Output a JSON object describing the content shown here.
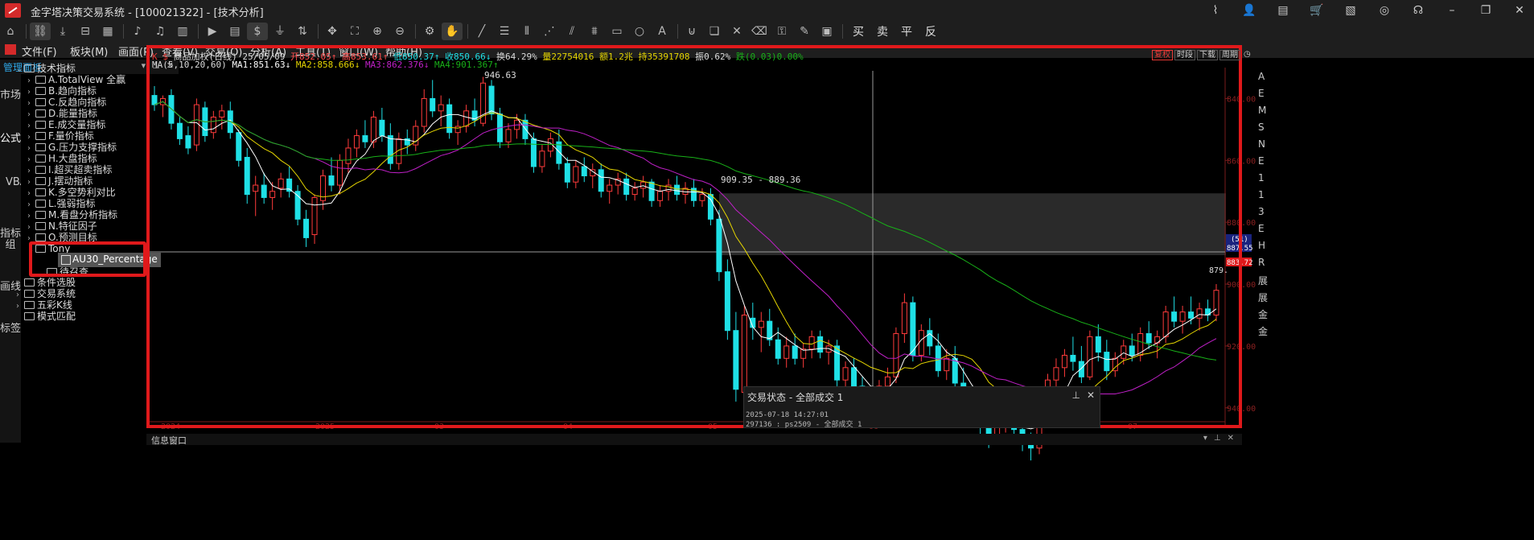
{
  "window": {
    "title": "金字塔决策交易系统 - [100021322] - [技术分析]"
  },
  "toolbar": {
    "trade_buttons": [
      "买",
      "卖",
      "平",
      "反"
    ]
  },
  "menu": {
    "items": [
      "文件(F)",
      "板块(M)",
      "画面(P)",
      "查看(V)",
      "交易(O)",
      "分析(A)",
      "工具(T)",
      "窗口(W)",
      "帮助(H)"
    ]
  },
  "side_tabs": {
    "items": [
      "市场",
      "公式",
      "VBA",
      "指标组",
      "画线",
      "标签"
    ]
  },
  "panel": {
    "title": "管理面板",
    "controls": [
      "▾",
      "⊥",
      "✕"
    ]
  },
  "tree": {
    "root": "技术指标",
    "items": [
      "A.TotalView 全赢",
      "B.趋向指标",
      "C.反趋向指标",
      "D.能量指标",
      "E.成交量指标",
      "F.量价指标",
      "G.压力支撑指标",
      "H.大盘指标",
      "I.超买超卖指标",
      "J.摆动指标",
      "K.多空势利对比",
      "L.强弱指标",
      "M.看盘分析指标",
      "N.特征因子",
      "O.预测目标"
    ],
    "tony": "Tony",
    "selected": "AU30_Percentage",
    "hidden_partial": "待召查",
    "roots_after": [
      "条件选股",
      "交易系统",
      "五彩K线"
    ],
    "last": "模式匹配"
  },
  "chart": {
    "header": {
      "name": "商品加权(日线)",
      "date": "25/05/09",
      "open": "开852.05",
      "high": "高853.61",
      "low": "低850.37",
      "close": "收850.66",
      "turnover": "换64.29%",
      "volume": "量22754016",
      "amount": "额1.2兆",
      "open_interest": "持35391708",
      "amplitude": "振0.62%",
      "change": "跌(0.03)0.00%"
    },
    "ma_line": {
      "label": "MA(5,10,20,60)",
      "ma1": "MA1:851.63",
      "ma2": "MA2:858.666",
      "ma3": "MA3:862.376",
      "ma4": "MA4:901.367"
    },
    "buttons": [
      "复权",
      "时段",
      "下载",
      "周期"
    ],
    "annotations": {
      "peak": "946.63",
      "range": "909.35 - 889.36",
      "cursor_tag": "(51)",
      "cursor_price": "887.55",
      "last_price": "883.72",
      "trough_price": "879."
    },
    "y_ticks": [
      "940.00",
      "920.00",
      "900.00",
      "880.00",
      "860.00",
      "840.00"
    ],
    "x_ticks": [
      "2024",
      "2025",
      "03",
      "04",
      "05",
      "06",
      "07"
    ],
    "colors": {
      "up": "#ff3b3b",
      "down": "#1fe0e6",
      "ma1": "#ffffff",
      "ma2": "#e5d500",
      "ma3": "#c020c8",
      "ma4": "#18b018",
      "highlight": "#e0191b"
    }
  },
  "chart_data": {
    "type": "candlestick",
    "title": "商品加权(日线)",
    "series": [
      {
        "name": "商品加权(日线)",
        "ohlc": [
          [
            941,
            944,
            936,
            938
          ],
          [
            938,
            941,
            934,
            940
          ],
          [
            941,
            943,
            930,
            932
          ],
          [
            932,
            934,
            925,
            927
          ],
          [
            928,
            931,
            922,
            924
          ],
          [
            925,
            940,
            923,
            938
          ],
          [
            937,
            939,
            926,
            928
          ],
          [
            929,
            936,
            927,
            934
          ],
          [
            934,
            938,
            930,
            936
          ],
          [
            936,
            939,
            927,
            929
          ],
          [
            929,
            930,
            918,
            920
          ],
          [
            921,
            924,
            906,
            909
          ],
          [
            910,
            915,
            902,
            912
          ],
          [
            912,
            916,
            906,
            908
          ],
          [
            908,
            913,
            904,
            910
          ],
          [
            911,
            916,
            908,
            914
          ],
          [
            914,
            918,
            908,
            910
          ],
          [
            910,
            912,
            899,
            901
          ],
          [
            901,
            904,
            892,
            895
          ],
          [
            896,
            909,
            893,
            908
          ],
          [
            907,
            917,
            904,
            915
          ],
          [
            915,
            921,
            910,
            912
          ],
          [
            912,
            922,
            909,
            920
          ],
          [
            919,
            927,
            916,
            924
          ],
          [
            924,
            930,
            921,
            928
          ],
          [
            928,
            933,
            924,
            926
          ],
          [
            926,
            936,
            924,
            934
          ],
          [
            933,
            937,
            926,
            928
          ],
          [
            928,
            932,
            917,
            919
          ],
          [
            919,
            929,
            917,
            927
          ],
          [
            927,
            930,
            922,
            925
          ],
          [
            925,
            933,
            923,
            931
          ],
          [
            931,
            943,
            929,
            940
          ],
          [
            940,
            946,
            934,
            936
          ],
          [
            936,
            941,
            931,
            938
          ],
          [
            938,
            940,
            927,
            929
          ],
          [
            929,
            933,
            925,
            931
          ],
          [
            931,
            938,
            929,
            936
          ],
          [
            936,
            940,
            931,
            933
          ],
          [
            932,
            947,
            931,
            945
          ],
          [
            944,
            946,
            933,
            935
          ],
          [
            935,
            937,
            924,
            926
          ],
          [
            926,
            932,
            924,
            930
          ],
          [
            930,
            935,
            927,
            933
          ],
          [
            933,
            935,
            925,
            927
          ],
          [
            927,
            929,
            916,
            918
          ],
          [
            918,
            925,
            916,
            923
          ],
          [
            923,
            929,
            921,
            927
          ],
          [
            926,
            930,
            917,
            919
          ],
          [
            919,
            921,
            911,
            913
          ],
          [
            913,
            920,
            911,
            918
          ],
          [
            918,
            921,
            913,
            915
          ],
          [
            915,
            919,
            911,
            917
          ],
          [
            917,
            919,
            908,
            910
          ],
          [
            910,
            914,
            906,
            912
          ],
          [
            912,
            916,
            909,
            914
          ],
          [
            914,
            916,
            907,
            909
          ],
          [
            909,
            913,
            907,
            911
          ],
          [
            911,
            915,
            908,
            913
          ],
          [
            913,
            914,
            905,
            907
          ],
          [
            907,
            912,
            905,
            910
          ],
          [
            910,
            914,
            907,
            912
          ],
          [
            912,
            915,
            907,
            909
          ],
          [
            909,
            913,
            906,
            911
          ],
          [
            911,
            914,
            905,
            907
          ],
          [
            907,
            911,
            905,
            909
          ],
          [
            909,
            911,
            899,
            901
          ],
          [
            901,
            904,
            881,
            884
          ],
          [
            884,
            888,
            862,
            865
          ],
          [
            865,
            871,
            842,
            846
          ],
          [
            845,
            873,
            843,
            870
          ],
          [
            869,
            874,
            862,
            866
          ],
          [
            866,
            871,
            858,
            868
          ],
          [
            868,
            872,
            860,
            862
          ],
          [
            862,
            866,
            854,
            856
          ],
          [
            856,
            863,
            853,
            860
          ],
          [
            860,
            864,
            854,
            856
          ],
          [
            856,
            861,
            853,
            859
          ],
          [
            859,
            865,
            856,
            863
          ],
          [
            863,
            865,
            856,
            858
          ],
          [
            858,
            862,
            854,
            860
          ],
          [
            860,
            862,
            847,
            849
          ],
          [
            849,
            855,
            846,
            853
          ],
          [
            853,
            856,
            845,
            847
          ],
          [
            847,
            850,
            840,
            842
          ],
          [
            842,
            846,
            837,
            844
          ],
          [
            844,
            849,
            841,
            847
          ],
          [
            847,
            853,
            845,
            850
          ],
          [
            850,
            866,
            848,
            864
          ],
          [
            864,
            877,
            861,
            874
          ],
          [
            874,
            876,
            855,
            857
          ],
          [
            857,
            867,
            855,
            865
          ],
          [
            865,
            869,
            857,
            860
          ],
          [
            860,
            864,
            850,
            852
          ],
          [
            852,
            859,
            849,
            856
          ],
          [
            856,
            860,
            846,
            848
          ],
          [
            848,
            853,
            841,
            843
          ],
          [
            843,
            847,
            835,
            838
          ],
          [
            838,
            842,
            831,
            834
          ],
          [
            834,
            837,
            827,
            830
          ],
          [
            830,
            836,
            828,
            834
          ],
          [
            834,
            845,
            832,
            843
          ],
          [
            843,
            846,
            831,
            833
          ],
          [
            833,
            838,
            826,
            829
          ],
          [
            829,
            832,
            823,
            827
          ],
          [
            827,
            840,
            825,
            838
          ],
          [
            838,
            851,
            836,
            849
          ],
          [
            849,
            856,
            846,
            853
          ],
          [
            853,
            859,
            850,
            857
          ],
          [
            857,
            863,
            852,
            855
          ],
          [
            855,
            860,
            848,
            850
          ],
          [
            850,
            865,
            849,
            863
          ],
          [
            863,
            867,
            855,
            858
          ],
          [
            858,
            862,
            849,
            852
          ],
          [
            852,
            858,
            850,
            856
          ],
          [
            856,
            862,
            854,
            860
          ],
          [
            860,
            864,
            855,
            857
          ],
          [
            857,
            866,
            855,
            864
          ],
          [
            864,
            868,
            859,
            861
          ],
          [
            861,
            865,
            856,
            863
          ],
          [
            863,
            873,
            861,
            871
          ],
          [
            871,
            876,
            866,
            868
          ],
          [
            868,
            873,
            864,
            871
          ],
          [
            871,
            876,
            867,
            869
          ],
          [
            869,
            874,
            865,
            872
          ],
          [
            872,
            875,
            868,
            870
          ],
          [
            870,
            880,
            868,
            878
          ]
        ]
      }
    ],
    "ylim": [
      835,
      950
    ],
    "y_ticks": [
      840,
      860,
      880,
      900,
      920,
      940
    ],
    "x_labels": [
      "2024",
      "2025",
      "03",
      "04",
      "05",
      "06",
      "07"
    ],
    "moving_averages": [
      5,
      10,
      20,
      60
    ],
    "shaded_range": [
      889.36,
      909.35
    ],
    "grid": false,
    "legend": "top-left"
  },
  "trade_panel": {
    "title": "交易状态 - 全部成交 1",
    "controls": [
      "⊥",
      "✕"
    ],
    "lines": [
      "2025-07-18 14:27:01",
      "297136 : ps2509 - 全部成交 1"
    ]
  },
  "info": {
    "label": "信息窗口"
  },
  "right_strip": {
    "chars": [
      "A",
      "E",
      "M",
      "S",
      "N",
      "E",
      "1",
      "1",
      "3",
      "E",
      "H",
      "R",
      "展",
      "展",
      "金",
      "金"
    ]
  }
}
